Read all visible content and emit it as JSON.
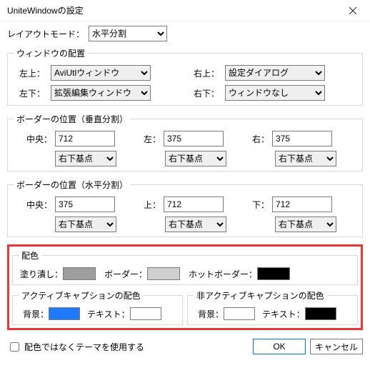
{
  "window": {
    "title": "UniteWindowの設定"
  },
  "layout_mode": {
    "label": "レイアウトモード：",
    "value": "水平分割"
  },
  "placement": {
    "legend": "ウィンドウの配置",
    "tl_label": "左上：",
    "tl_value": "AviUtlウィンドウ",
    "tr_label": "右上：",
    "tr_value": "設定ダイアログ",
    "bl_label": "左下：",
    "bl_value": "拡張編集ウィンドウ",
    "br_label": "右下：",
    "br_value": "ウィンドウなし"
  },
  "border_v": {
    "legend": "ボーダーの位置（垂直分割）",
    "c_label": "中央：",
    "c_value": "712",
    "l_label": "左：",
    "l_value": "375",
    "r_label": "右：",
    "r_value": "375",
    "origin": "右下基点"
  },
  "border_h": {
    "legend": "ボーダーの位置（水平分割）",
    "c_label": "中央：",
    "c_value": "375",
    "t_label": "上：",
    "t_value": "712",
    "b_label": "下：",
    "b_value": "712",
    "origin": "右下基点"
  },
  "colors": {
    "legend": "配色",
    "fill_label": "塗り潰し：",
    "fill_color": "#9e9e9e",
    "border_label": "ボーダー：",
    "border_color": "#cfcfcf",
    "hot_label": "ホットボーダー：",
    "hot_color": "#000000"
  },
  "caption_active": {
    "legend": "アクティブキャプションの配色",
    "bg_label": "背景：",
    "bg_color": "#1e7bff",
    "text_label": "テキスト：",
    "text_color": "#ffffff"
  },
  "caption_inactive": {
    "legend": "非アクティブキャプションの配色",
    "bg_label": "背景：",
    "bg_color": "#ffffff",
    "text_label": "テキスト：",
    "text_color": "#000000"
  },
  "footer": {
    "theme_checkbox": "配色ではなくテーマを使用する",
    "ok": "OK",
    "cancel": "キャンセル"
  }
}
